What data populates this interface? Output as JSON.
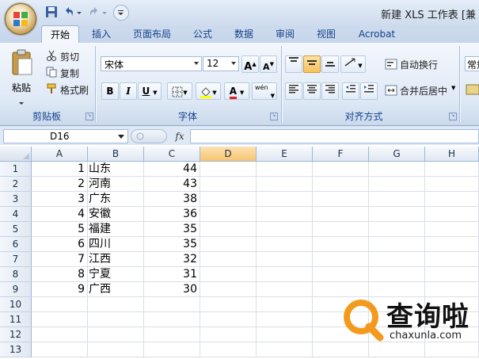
{
  "window": {
    "title": "新建 XLS 工作表 [兼"
  },
  "tabs": [
    "开始",
    "插入",
    "页面布局",
    "公式",
    "数据",
    "审阅",
    "视图",
    "Acrobat"
  ],
  "active_tab": "开始",
  "ribbon": {
    "clipboard": {
      "label": "剪贴板",
      "paste": "粘贴",
      "cut": "剪切",
      "copy": "复制",
      "format_painter": "格式刷"
    },
    "font": {
      "label": "字体",
      "font_name": "宋体",
      "font_size": "12",
      "grow": "A",
      "shrink": "A",
      "bold": "B",
      "italic": "I",
      "underline": "U",
      "font_color_letter": "A",
      "phonetic": "wén"
    },
    "alignment": {
      "label": "对齐方式",
      "wrap_text": "自动换行",
      "merge_center": "合并后居中"
    },
    "number": {
      "format_value": "常规"
    }
  },
  "formula_bar": {
    "name_box": "D16",
    "fx": "fx",
    "formula": ""
  },
  "sheet": {
    "columns": [
      "A",
      "B",
      "C",
      "D",
      "E",
      "F",
      "G",
      "H"
    ],
    "selected_column": "D",
    "row_numbers": [
      "1",
      "2",
      "3",
      "4",
      "5",
      "6",
      "7",
      "8",
      "9",
      "10",
      "11",
      "12",
      "13"
    ],
    "rows": [
      {
        "a": "1",
        "b": "山东",
        "c": "44"
      },
      {
        "a": "2",
        "b": "河南",
        "c": "43"
      },
      {
        "a": "3",
        "b": "广东",
        "c": "38"
      },
      {
        "a": "4",
        "b": "安徽",
        "c": "36"
      },
      {
        "a": "5",
        "b": "福建",
        "c": "35"
      },
      {
        "a": "6",
        "b": "四川",
        "c": "35"
      },
      {
        "a": "7",
        "b": "江西",
        "c": "32"
      },
      {
        "a": "8",
        "b": "宁夏",
        "c": "31"
      },
      {
        "a": "9",
        "b": "广西",
        "c": "30"
      }
    ]
  },
  "watermark": {
    "brand": "查询啦",
    "domain": "chaxunla.com"
  },
  "colors": {
    "accent": "#15428b",
    "selected_header": "#f8c46d",
    "watermark_orange": "#f39a1e"
  }
}
